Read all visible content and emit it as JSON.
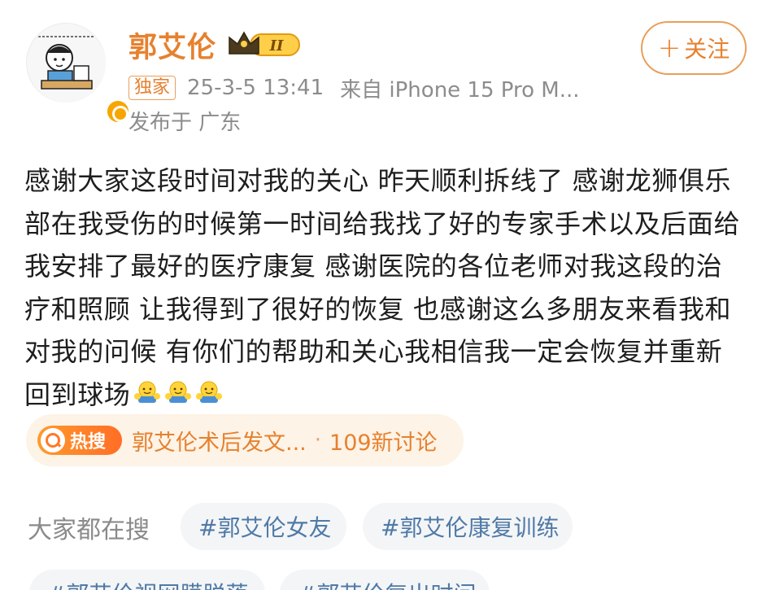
{
  "user": {
    "name": "郭艾伦",
    "vip_level": "II",
    "follow_label": "关注",
    "follow_plus": "+"
  },
  "post_meta": {
    "badge": "独家",
    "time": "25-3-5 13:41",
    "source": "来自 iPhone 15 Pro M...",
    "location": "发布于 广东"
  },
  "content": {
    "text": "感谢大家这段时间对我的关心 昨天顺利拆线了 感谢龙狮俱乐部在我受伤的时候第一时间给我找了好的专家手术以及后面给我安排了最好的医疗康复 感谢医院的各位老师对我这段的治疗和照顾 让我得到了很好的恢复 也感谢这么多朋友来看我和对我的问候 有你们的帮助和关心我相信我一定会恢复并重新回到球场",
    "emoji_names": [
      "hug-emoji",
      "hug-emoji",
      "hug-emoji"
    ]
  },
  "hot_search": {
    "tag": "热搜",
    "title": "郭艾伦术后发文...",
    "separator": "·",
    "count": "109新讨论"
  },
  "searches": {
    "label": "大家都在搜",
    "chips": [
      "#郭艾伦女友",
      "#郭艾伦康复训练",
      "#郭艾伦视网膜脱落",
      "#郭艾伦复出时间"
    ]
  },
  "colors": {
    "accent": "#e6812f",
    "hot_bg": "#fdf3e6",
    "chip_text": "#4f7aa6",
    "chip_bg": "#f4f5f7",
    "meta_text": "#8c8c8c"
  }
}
